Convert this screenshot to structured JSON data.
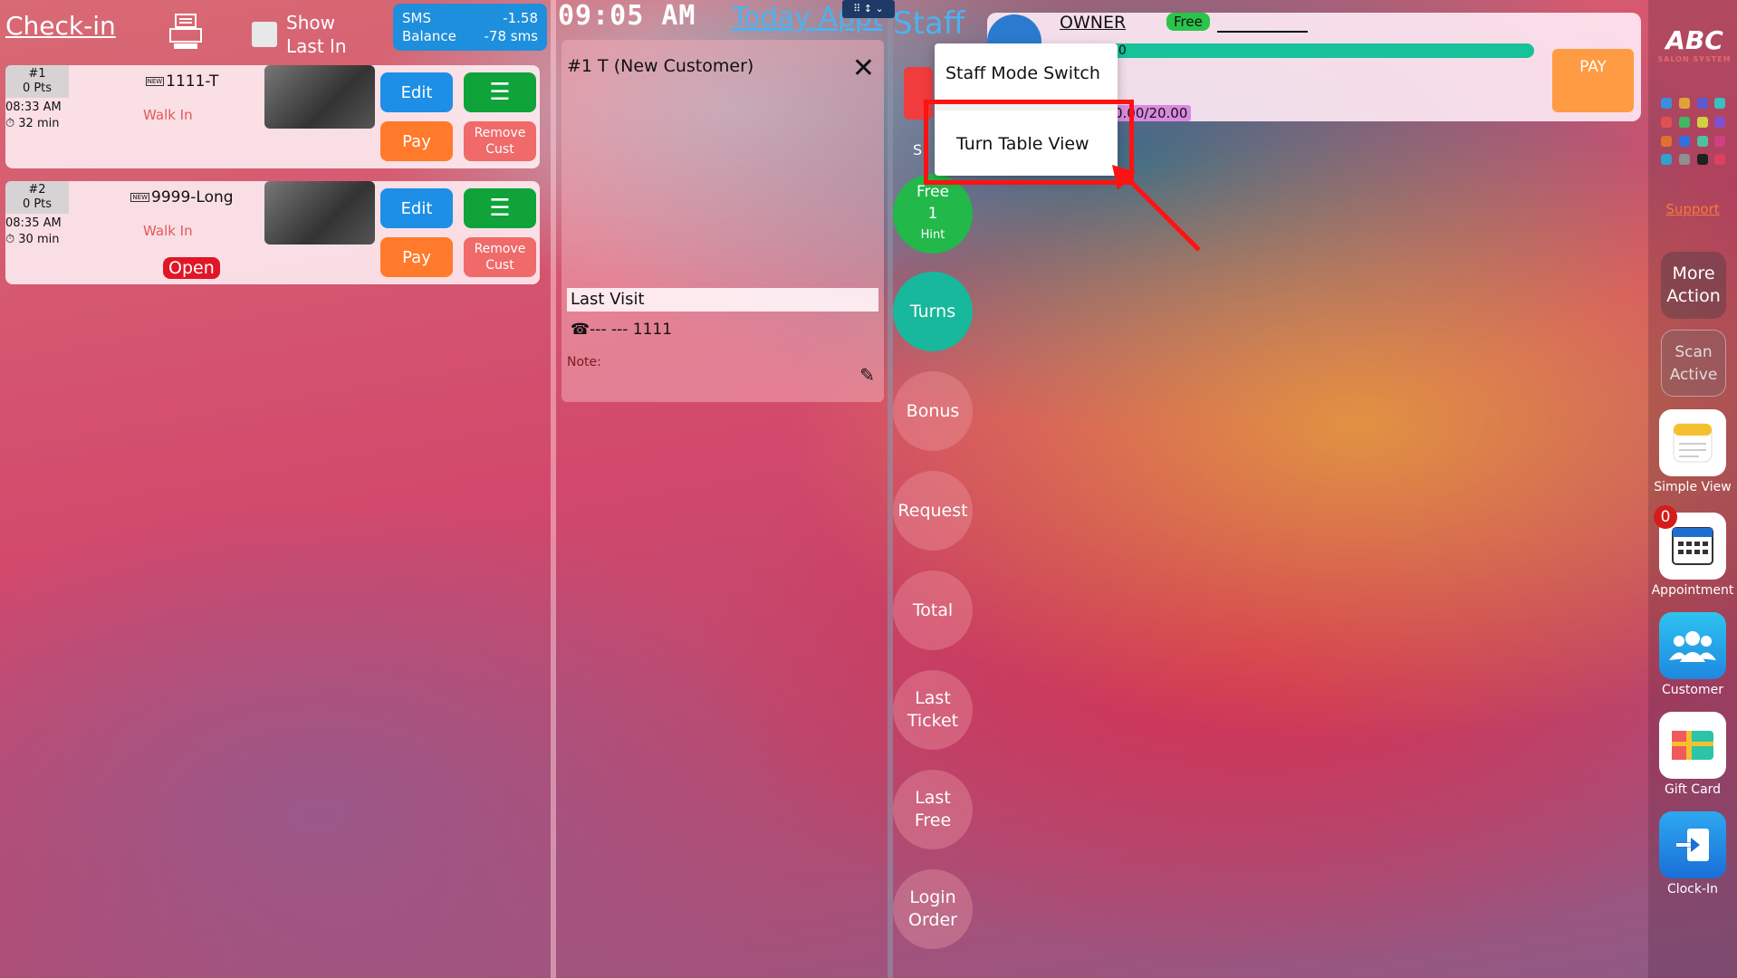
{
  "checkin": {
    "title": "Check-in",
    "show_last_in_label_1": "Show",
    "show_last_in_label_2": "Last In",
    "sms": {
      "label_1": "SMS",
      "label_2": "Balance",
      "value_1": "-1.58",
      "value_2": "-78 sms"
    },
    "tickets": [
      {
        "number": "#1",
        "points": "0 Pts",
        "time": "08:33 AM",
        "elapsed": "⏱ 32 min",
        "new_tag": "NEW",
        "name": "1111-T",
        "type": "Walk In",
        "edit": "Edit",
        "menu": "☰",
        "pay": "Pay",
        "remove_1": "Remove",
        "remove_2": "Cust"
      },
      {
        "number": "#2",
        "points": "0 Pts",
        "time": "08:35 AM",
        "elapsed": "⏱ 30 min",
        "new_tag": "NEW",
        "name": "9999-Long",
        "type": "Walk In",
        "edit": "Edit",
        "menu": "☰",
        "pay": "Pay",
        "remove_1": "Remove",
        "remove_2": "Cust",
        "badge": "Open"
      }
    ]
  },
  "middle": {
    "clock": "09:05 AM",
    "today_appt": "Today Appt",
    "handle": "⠿ ↕ ⌄",
    "customer": {
      "title": "#1 T (New Customer)",
      "close": "✕",
      "last_visit": "Last Visit",
      "phone": "☎--- --- 1111",
      "note_label": "Note:",
      "edit_icon": "✎"
    }
  },
  "staff": {
    "title": "Staff",
    "s_label": "S",
    "buttons": {
      "free_1": "Free",
      "free_2": "1",
      "free_hint": "Hint",
      "turns": "Turns",
      "bonus": "Bonus",
      "request": "Request",
      "total": "Total",
      "last_ticket_1": "Last",
      "last_ticket_2": "Ticket",
      "last_free_1": "Last",
      "last_free_2": "Free",
      "login_order_1": "Login",
      "login_order_2": "Order"
    },
    "card": {
      "owner": "OWNER",
      "status": "Free",
      "progress_text": "90",
      "amount": "0.00/20.00",
      "pay": "PAY"
    },
    "menu": {
      "item_1": "Staff Mode Switch",
      "item_2": "Turn Table View"
    }
  },
  "sidebar": {
    "logo": "ABC",
    "logo_sub": "SALON SYSTEM",
    "support": "Support",
    "more_action_1": "More",
    "more_action_2": "Action",
    "scan_active_1": "Scan",
    "scan_active_2": "Active",
    "apps": [
      {
        "label": "Simple View",
        "icon": "notes-icon"
      },
      {
        "label": "Appointment",
        "icon": "calendar-icon",
        "badge": "0"
      },
      {
        "label": "Customer",
        "icon": "people-icon"
      },
      {
        "label": "Gift Card",
        "icon": "gift-icon"
      },
      {
        "label": "Clock-In",
        "icon": "clock-in-icon"
      }
    ]
  },
  "colors": {
    "accent_blue": "#4ab3f0",
    "edit_blue": "#1e8fe6",
    "green": "#0fa33a",
    "orange": "#ff7a2a",
    "red_remove": "#f06a6a",
    "highlight_red": "#ff1212"
  }
}
